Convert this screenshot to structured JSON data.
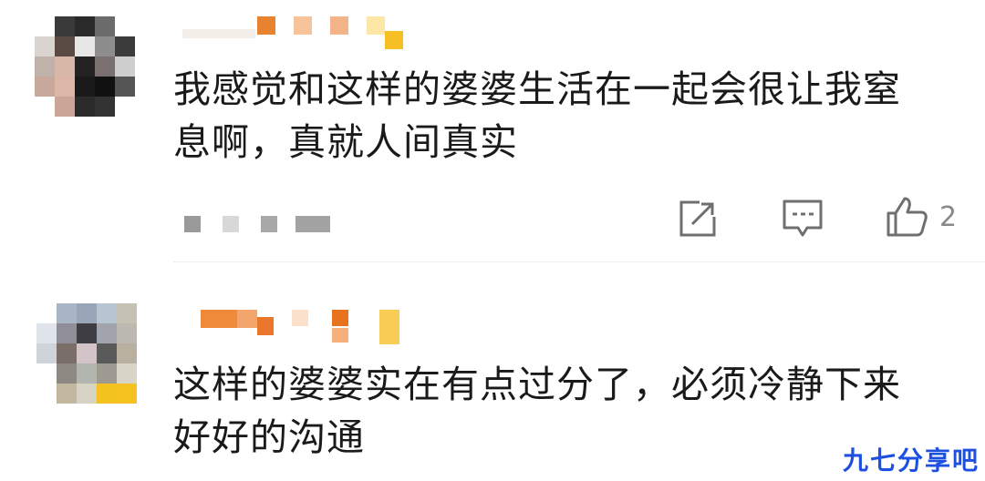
{
  "comments": [
    {
      "text_line1": "我感觉和这样的婆婆生活在一起会很让我窒",
      "text_line2": "息啊，真就人间真实",
      "like_count": "2",
      "avatar_icon": "pixelated-avatar",
      "username_icon": "pixelated-username"
    },
    {
      "text_line1": "这样的婆婆实在有点过分了，必须冷静下来",
      "text_line2": "好好的沟通",
      "avatar_icon": "pixelated-avatar",
      "username_icon": "pixelated-username"
    }
  ],
  "actions": {
    "share_icon": "share-icon",
    "reply_icon": "comment-icon",
    "like_icon": "thumbs-up-icon"
  },
  "watermark": "九七分享吧",
  "colors": {
    "text": "#1a1a1a",
    "muted": "#888888",
    "watermark": "#1d4fe0"
  }
}
